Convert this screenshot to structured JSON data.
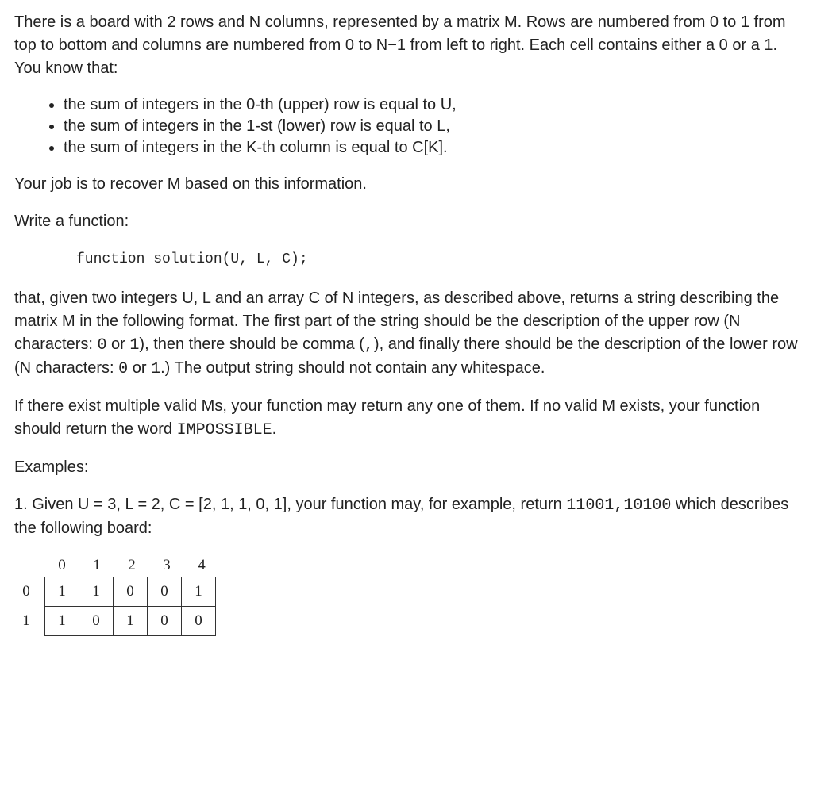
{
  "p1": "There is a board with 2 rows and N columns, represented by a matrix M. Rows are numbered from 0 to 1 from top to bottom and columns are numbered from 0 to N−1 from left to right. Each cell contains either a 0 or a 1. You know that:",
  "bullets": [
    "the sum of integers in the 0-th (upper) row is equal to U,",
    "the sum of integers in the 1-st (lower) row is equal to L,",
    "the sum of integers in the K-th column is equal to C[K]."
  ],
  "p2": "Your job is to recover M based on this information.",
  "p3": "Write a function:",
  "code": "function solution(U, L, C);",
  "p4_pre": "that, given two integers U, L and an array C of N integers, as described above, returns a string describing the matrix M in the following format. The first part of the string should be the description of the upper row (N characters: ",
  "p4_mono1": "0",
  "p4_mid1": " or ",
  "p4_mono2": "1",
  "p4_mid2": "), then there should be comma (",
  "p4_mono3": ",",
  "p4_mid3": "), and finally there should be the description of the lower row (N characters: ",
  "p4_mono4": "0",
  "p4_mid4": " or ",
  "p4_mono5": "1",
  "p4_end": ".) The output string should not contain any whitespace.",
  "p5_pre": "If there exist multiple valid Ms, your function may return any one of them. If no valid M exists, your function should return the word ",
  "p5_mono": "IMPOSSIBLE",
  "p5_end": ".",
  "examples_label": "Examples:",
  "ex1_pre": "1. Given U = 3, L = 2, C = [2, 1, 1, 0, 1], your function may, for example, return ",
  "ex1_mono": "11001,10100",
  "ex1_end": " which describes the following board:",
  "chart_data": {
    "type": "table",
    "col_headers": [
      "0",
      "1",
      "2",
      "3",
      "4"
    ],
    "rows": [
      {
        "label": "0",
        "cells": [
          "1",
          "1",
          "0",
          "0",
          "1"
        ]
      },
      {
        "label": "1",
        "cells": [
          "1",
          "0",
          "1",
          "0",
          "0"
        ]
      }
    ]
  }
}
